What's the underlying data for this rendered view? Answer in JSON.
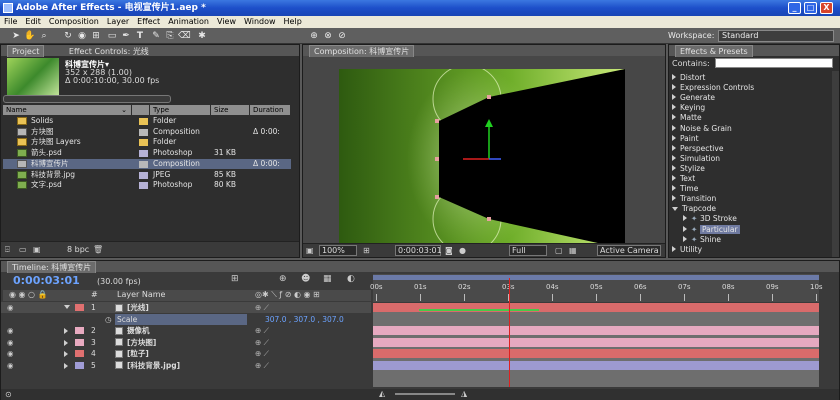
{
  "window": {
    "title": "Adobe After Effects - 电视宣传片1.aep *",
    "min": "_",
    "max": "□",
    "close": "X"
  },
  "menu": [
    "File",
    "Edit",
    "Composition",
    "Layer",
    "Effect",
    "Animation",
    "View",
    "Window",
    "Help"
  ],
  "workspace": {
    "label": "Workspace:",
    "value": "Standard"
  },
  "project": {
    "tabs": [
      "Project",
      "Effect Controls: 光线"
    ],
    "item_name": "科博宣传片▾",
    "item_info1": "352 x 288 (1.00)",
    "item_info2": "Δ 0:00:10:00, 30.00 fps",
    "columns": [
      "Name",
      "Type",
      "Size",
      "Duration"
    ],
    "rows": [
      {
        "name": "Solids",
        "type": "Folder",
        "size": "",
        "duration": "",
        "icon": "folder",
        "label": "#e9c255"
      },
      {
        "name": "方块图",
        "type": "Composition",
        "size": "",
        "duration": "Δ 0:00:",
        "icon": "comp",
        "label": "#b8b8b8"
      },
      {
        "name": "方块图 Layers",
        "type": "Folder",
        "size": "",
        "duration": "",
        "icon": "folder",
        "label": "#e9c255"
      },
      {
        "name": "箭头.psd",
        "type": "Photoshop",
        "size": "31 KB",
        "duration": "",
        "icon": "img",
        "label": "#b6b2d6"
      },
      {
        "name": "科博宣传片",
        "type": "Composition",
        "size": "",
        "duration": "Δ 0:00:",
        "icon": "comp",
        "label": "#b8b8b8"
      },
      {
        "name": "科技背景.jpg",
        "type": "JPEG",
        "size": "85 KB",
        "duration": "",
        "icon": "img",
        "label": "#b6b2d6"
      },
      {
        "name": "文字.psd",
        "type": "Photoshop",
        "size": "80 KB",
        "duration": "",
        "icon": "img",
        "label": "#b6b2d6"
      }
    ],
    "bpc": "8 bpc"
  },
  "comp": {
    "tab": "Composition: 科博宣传片",
    "zoom": "100%",
    "timecode": "0:00:03:01",
    "resolution": "Full",
    "camera": "Active Camera"
  },
  "effects": {
    "tab": "Effects & Presets",
    "contains_label": "Contains:",
    "items": [
      {
        "label": "Distort",
        "indent": 0,
        "open": false
      },
      {
        "label": "Expression Controls",
        "indent": 0,
        "open": false
      },
      {
        "label": "Generate",
        "indent": 0,
        "open": false
      },
      {
        "label": "Keying",
        "indent": 0,
        "open": false
      },
      {
        "label": "Matte",
        "indent": 0,
        "open": false
      },
      {
        "label": "Noise & Grain",
        "indent": 0,
        "open": false
      },
      {
        "label": "Paint",
        "indent": 0,
        "open": false
      },
      {
        "label": "Perspective",
        "indent": 0,
        "open": false
      },
      {
        "label": "Simulation",
        "indent": 0,
        "open": false
      },
      {
        "label": "Stylize",
        "indent": 0,
        "open": false
      },
      {
        "label": "Text",
        "indent": 0,
        "open": false
      },
      {
        "label": "Time",
        "indent": 0,
        "open": false
      },
      {
        "label": "Transition",
        "indent": 0,
        "open": false
      },
      {
        "label": "Trapcode",
        "indent": 0,
        "open": true
      },
      {
        "label": "3D Stroke",
        "indent": 1,
        "open": false
      },
      {
        "label": "Particular",
        "indent": 1,
        "open": false,
        "selected": true
      },
      {
        "label": "Shine",
        "indent": 1,
        "open": false
      },
      {
        "label": "Utility",
        "indent": 0,
        "open": false
      }
    ]
  },
  "timeline": {
    "tab": "Timeline: 科博宣传片",
    "timecode": "0:00:03:01",
    "fps": "(30.00 fps)",
    "columns": {
      "num": "#",
      "name": "Layer Name"
    },
    "ruler": [
      "00s",
      "01s",
      "02s",
      "03s",
      "04s",
      "05s",
      "06s",
      "07s",
      "08s",
      "09s",
      "10s"
    ],
    "current_time_sec": 3.03,
    "layers": [
      {
        "num": "1",
        "name": "[光线]",
        "bar": "#d96b6b",
        "label": "#e07070",
        "expanded": true
      },
      {
        "num": "2",
        "name": "摄像机",
        "bar": "#e6a9c0",
        "label": "#e8aac0",
        "expanded": false
      },
      {
        "num": "3",
        "name": "[方块图]",
        "bar": "#e6a9c0",
        "label": "#e8aac0",
        "expanded": false
      },
      {
        "num": "4",
        "name": "[粒子]",
        "bar": "#d96b6b",
        "label": "#e07070",
        "expanded": false
      },
      {
        "num": "5",
        "name": "[科技背景.jpg]",
        "bar": "#9d9ad0",
        "label": "#a09cd6",
        "expanded": false
      }
    ],
    "scale_label": "Scale",
    "scale_value": "307.0 , 307.0 , 307.0"
  }
}
